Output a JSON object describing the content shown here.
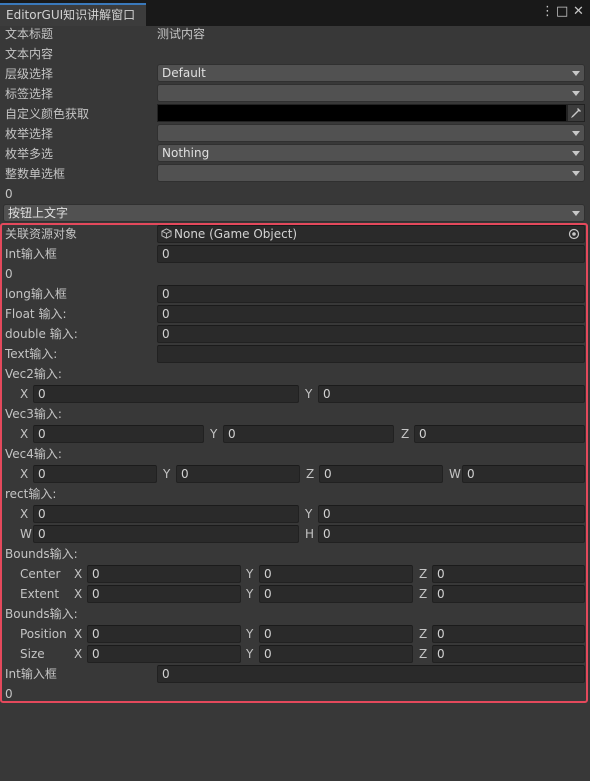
{
  "window": {
    "tab_title": "EditorGUI知识讲解窗口",
    "menu_icon": "⋮",
    "maximize_icon": "□",
    "close_icon": "✕"
  },
  "rows": {
    "text_title_label": "文本标题",
    "text_title_value": "测试内容",
    "text_content_label": "文本内容",
    "layer_label": "层级选择",
    "layer_value": "Default",
    "tag_label": "标签选择",
    "tag_value": "",
    "color_label": "自定义颜色获取",
    "color_value": "#000000",
    "enum_label": "枚举选择",
    "enum_value": "",
    "enum_mask_label": "枚举多选",
    "enum_mask_value": "Nothing",
    "int_popup_label": "整数单选框",
    "int_popup_value": "",
    "int_popup_result": "0",
    "dropdown_button_label": "按钮上文字"
  },
  "section": {
    "object_label": "关联资源对象",
    "object_value": "None (Game Object)",
    "int1_label": "Int输入框",
    "int1_value": "0",
    "int1_result": "0",
    "long_label": "long输入框",
    "long_value": "0",
    "float_label": "Float 输入:",
    "float_value": "0",
    "double_label": "double 输入:",
    "double_value": "0",
    "text_label": "Text输入:",
    "text_value": "",
    "vec2_label": "Vec2输入:",
    "vec2": {
      "x": "0",
      "y": "0"
    },
    "vec3_label": "Vec3输入:",
    "vec3": {
      "x": "0",
      "y": "0",
      "z": "0"
    },
    "vec4_label": "Vec4输入:",
    "vec4": {
      "x": "0",
      "y": "0",
      "z": "0",
      "w": "0"
    },
    "rect_label": "rect输入:",
    "rect": {
      "x": "0",
      "y": "0",
      "w": "0",
      "h": "0"
    },
    "bounds1_label": "Bounds输入:",
    "bounds1": {
      "center_label": "Center",
      "extent_label": "Extent",
      "center": {
        "x": "0",
        "y": "0",
        "z": "0"
      },
      "extent": {
        "x": "0",
        "y": "0",
        "z": "0"
      }
    },
    "bounds2_label": "Bounds输入:",
    "bounds2": {
      "position_label": "Position",
      "size_label": "Size",
      "position": {
        "x": "0",
        "y": "0",
        "z": "0"
      },
      "size": {
        "x": "0",
        "y": "0",
        "z": "0"
      }
    },
    "int2_label": "Int输入框",
    "int2_value": "0",
    "int2_result": "0"
  },
  "axis": {
    "x": "X",
    "y": "Y",
    "z": "Z",
    "w": "W",
    "h": "H"
  },
  "colors": {
    "highlight": "#e4495c",
    "accent": "#3a79bb"
  }
}
